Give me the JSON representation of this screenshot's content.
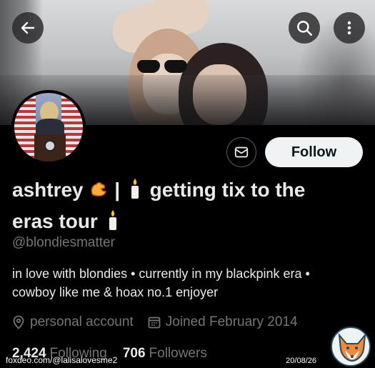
{
  "header": {
    "back_icon": "arrow-left-icon",
    "search_icon": "search-icon",
    "more_icon": "more-vertical-icon"
  },
  "actions": {
    "message_icon": "envelope-icon",
    "follow_label": "Follow"
  },
  "profile": {
    "name_line1": "ashtrey",
    "name_sep": "|",
    "name_text": "getting tix to the",
    "name_line2": "eras tour",
    "handle": "@blondiesmatter",
    "bio_line1": "in love with blondies • currently in my blackpink era •",
    "bio_line2": "cowboy like me & hoax no.1 enjoyer",
    "category": "personal account",
    "joined": "Joined February 2014"
  },
  "stats": {
    "following_count": "2,424",
    "following_label": "Following",
    "followers_count": "706",
    "followers_label": "Followers"
  },
  "overlay": {
    "watermark": "foxdeo.com/@lalisalovesme2",
    "date": "20/08/26"
  },
  "colors": {
    "background": "#000000",
    "text_primary": "#e7e9ea",
    "text_secondary": "#71767b",
    "follow_bg": "#eff3f4"
  }
}
